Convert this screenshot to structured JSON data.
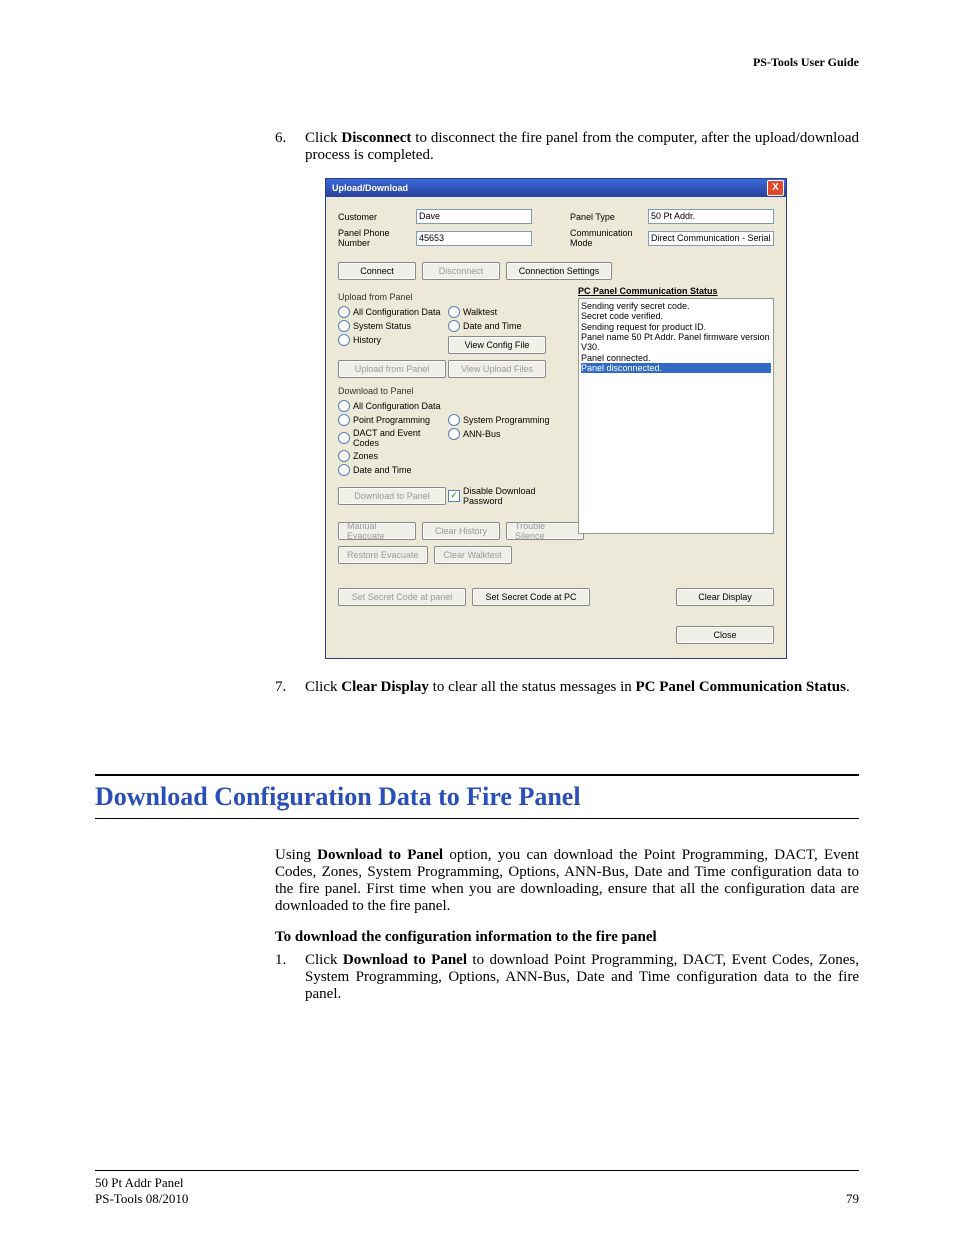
{
  "header": {
    "guide": "PS-Tools User Guide"
  },
  "steps": {
    "s6_num": "6.",
    "s6_a": "Click ",
    "s6_b": "Disconnect",
    "s6_c": " to disconnect the fire panel from the computer, after the upload/download process is completed.",
    "s7_num": "7.",
    "s7_a": "Click ",
    "s7_b": "Clear Display",
    "s7_c": " to clear all the status messages in ",
    "s7_d": "PC Panel Communication Status",
    "s7_e": "."
  },
  "dialog": {
    "title": "Upload/Download",
    "close": "X",
    "customer_lbl": "Customer",
    "customer_val": "Dave",
    "phone_lbl": "Panel Phone Number",
    "phone_val": "45653",
    "ptype_lbl": "Panel Type",
    "ptype_val": "50 Pt Addr.",
    "cmode_lbl": "Communication Mode",
    "cmode_val": "Direct Communication - Serial",
    "connect": "Connect",
    "disconnect": "Disconnect",
    "conn_settings": "Connection Settings",
    "upload_hdr": "Upload from Panel",
    "r_allconf": "All Configuration Data",
    "r_sysstat": "System Status",
    "r_history": "History",
    "r_walktest": "Walktest",
    "r_datetime": "Date and Time",
    "view_config": "View Config File",
    "upload_btn": "Upload from Panel",
    "view_upload": "View Upload Files",
    "download_hdr": "Download to Panel",
    "d_allconf": "All Configuration Data",
    "d_point": "Point Programming",
    "d_dact": "DACT and Event Codes",
    "d_zones": "Zones",
    "d_datetime": "Date and Time",
    "d_sysprog": "System Programming",
    "d_annbus": "ANN-Bus",
    "download_btn": "Download to Panel",
    "disable_pwd": "Disable Download Password",
    "man_evac": "Manual Evacuate",
    "clr_hist": "Clear History",
    "trbl_sil": "Trouble Silence",
    "rest_evac": "Restore Evacuate",
    "clr_walk": "Clear Walktest",
    "secret_panel": "Set Secret Code at panel",
    "secret_pc": "Set Secret Code at PC",
    "status_title": "PC Panel Communication Status",
    "status_lines": [
      "Sending verify secret code.",
      "Secret code verified.",
      "Sending request for product ID.",
      "Panel name 50 Pt Addr. Panel firmware version V30.",
      "Panel connected."
    ],
    "status_selected": "Panel disconnected.",
    "clear_display": "Clear Display",
    "close_btn": "Close"
  },
  "section": {
    "title": "Download Configuration Data to Fire Panel",
    "para_a": "Using ",
    "para_b": "Download to Panel",
    "para_c": " option, you can download the Point Programming, DACT, Event Codes, Zones, System Programming, Options, ANN-Bus, Date and Time configuration data to the fire panel. First time when you are downloading, ensure that all the configuration data are downloaded to the fire panel.",
    "sub": "To download the configuration information to the fire panel",
    "s1_num": "1.",
    "s1_a": "Click ",
    "s1_b": "Download to Panel",
    "s1_c": " to download Point Programming, DACT, Event Codes, Zones, System Programming, Options, ANN-Bus, Date and Time configuration data to the fire panel."
  },
  "footer": {
    "l1": "50 Pt Addr  Panel",
    "l2": "PS-Tools  08/2010",
    "page": "79"
  }
}
